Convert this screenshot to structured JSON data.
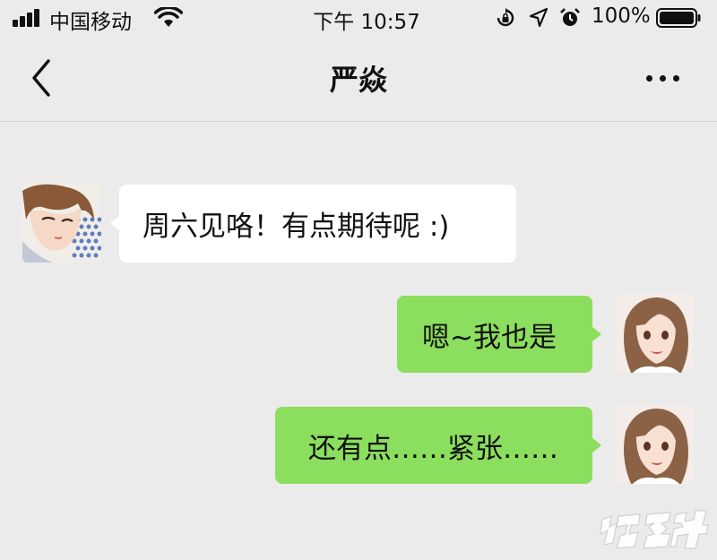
{
  "status_bar": {
    "carrier": "中国移动",
    "time": "下午 10:57",
    "battery_percent": "100%",
    "icons": [
      "signal-icon",
      "wifi-icon",
      "orientation-lock-icon",
      "location-arrow-icon",
      "alarm-clock-icon",
      "battery-icon"
    ]
  },
  "nav": {
    "title": "严焱",
    "back_icon": "chevron-left-icon",
    "more_icon": "more-dots-icon"
  },
  "messages": [
    {
      "direction": "incoming",
      "sender_avatar": "male-avatar",
      "text": "周六见咯！有点期待呢  :)"
    },
    {
      "direction": "outgoing",
      "sender_avatar": "female-avatar",
      "text": "嗯~我也是"
    },
    {
      "direction": "outgoing",
      "sender_avatar": "female-avatar",
      "text": "还有点……紧张……"
    }
  ],
  "colors": {
    "background": "#ebebeb",
    "incoming_bubble": "#ffffff",
    "outgoing_bubble": "#8cde5e",
    "text": "#111111"
  },
  "watermark": {
    "icon": "manhuake-logo"
  }
}
